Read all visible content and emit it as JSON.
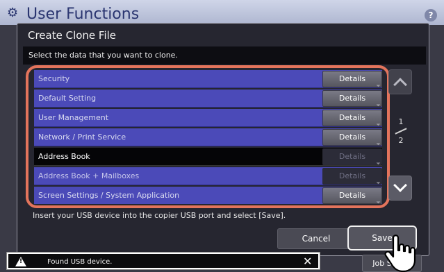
{
  "app": {
    "title": "User Functions",
    "help_label": "?"
  },
  "dialog": {
    "title": "Create Clone File",
    "instruction": "Select the data that you want to clone.",
    "rows": [
      {
        "label": "Security",
        "details": "Details",
        "selected": false,
        "details_enabled": true
      },
      {
        "label": "Default Setting",
        "details": "Details",
        "selected": false,
        "details_enabled": true
      },
      {
        "label": "User Management",
        "details": "Details",
        "selected": false,
        "details_enabled": true
      },
      {
        "label": "Network / Print Service",
        "details": "Details",
        "selected": false,
        "details_enabled": true
      },
      {
        "label": "Address Book",
        "details": "Details",
        "selected": true,
        "details_enabled": false
      },
      {
        "label": "Address Book + Mailboxes",
        "details": "Details",
        "selected": false,
        "details_enabled": false
      },
      {
        "label": "Screen Settings / System Application",
        "details": "Details",
        "selected": false,
        "details_enabled": true
      }
    ],
    "page": {
      "current": "1",
      "total": "2"
    },
    "usb_hint": "Insert your USB device into the copier USB port and select [Save].",
    "cancel_label": "Cancel",
    "save_label": "Save"
  },
  "toast": {
    "message": "Found USB device.",
    "close_label": "✕"
  },
  "jobs_label": "Job Status",
  "colors": {
    "accent_frame": "#e3745c",
    "row_bg": "#4b4ab8",
    "row_selected": "#050507"
  }
}
